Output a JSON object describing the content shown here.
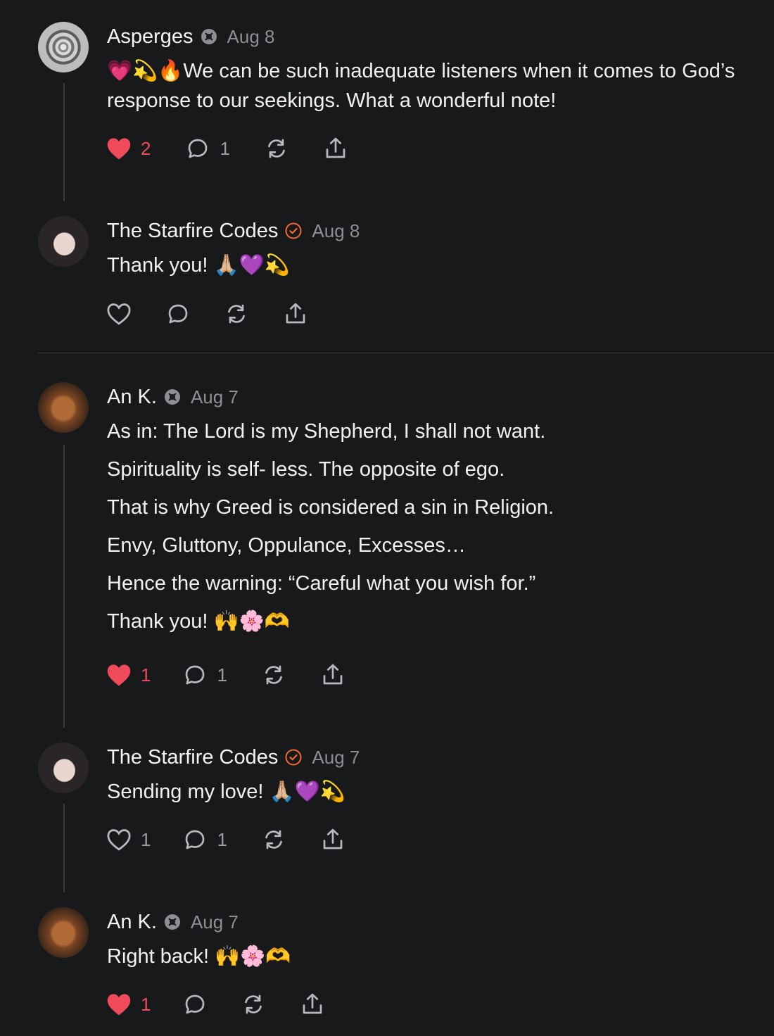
{
  "comments": [
    {
      "author": "Asperges",
      "date": "Aug 8",
      "text": [
        "💗💫🔥We can be such inadequate listeners when it comes to God’s response to our seekings. What a wonderful note!"
      ],
      "likes": "2",
      "replies": "1"
    },
    {
      "author": "The Starfire Codes",
      "date": "Aug 8",
      "text": [
        "Thank you! 🙏🏼💜💫"
      ],
      "likes": "",
      "replies": ""
    },
    {
      "author": "An K.",
      "date": "Aug 7",
      "text": [
        "As in: The Lord is my Shepherd, I shall not want.",
        "Spirituality is self- less. The opposite of ego.",
        "That is why Greed is considered a sin in Religion.",
        "Envy, Gluttony, Oppulance, Excesses…",
        "Hence the warning: “Careful what you wish for.”",
        "Thank you! 🙌🌸🫶"
      ],
      "likes": "1",
      "replies": "1"
    },
    {
      "author": "The Starfire Codes",
      "date": "Aug 7",
      "text": [
        "Sending my love! 🙏🏼💜💫"
      ],
      "likes": "1",
      "replies": "1"
    },
    {
      "author": "An K.",
      "date": "Aug 7",
      "text": [
        "Right back! 🙌🌸🫶"
      ],
      "likes": "1",
      "replies": ""
    }
  ],
  "colors": {
    "background": "#18191b",
    "like_active": "#ef4b5b",
    "verified_badge": "#f26a2e",
    "muted": "#8e8f93"
  },
  "icons": [
    "heart-icon",
    "comment-icon",
    "restack-icon",
    "share-icon",
    "subscriber-badge-icon",
    "verified-badge-icon"
  ]
}
